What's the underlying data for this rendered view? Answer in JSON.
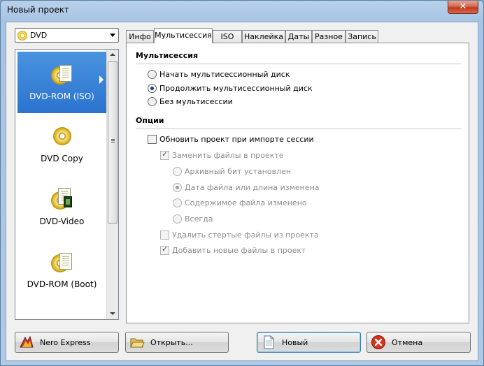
{
  "window": {
    "title": "Новый проект",
    "close_glyph": "✕"
  },
  "combo": {
    "value": "DVD",
    "icon": "dvd-disc-icon"
  },
  "projects": [
    {
      "label": "DVD-ROM (ISO)",
      "icon": "dvd-rom-iso-icon",
      "selected": true
    },
    {
      "label": "DVD Copy",
      "icon": "dvd-copy-icon",
      "selected": false
    },
    {
      "label": "DVD-Video",
      "icon": "dvd-video-icon",
      "selected": false
    },
    {
      "label": "DVD-ROM (Boot)",
      "icon": "dvd-rom-boot-icon",
      "selected": false
    }
  ],
  "tabs": [
    {
      "label": "Инфо",
      "active": false
    },
    {
      "label": "Мультисессия",
      "active": true
    },
    {
      "label": "ISO",
      "active": false
    },
    {
      "label": "Наклейка",
      "active": false
    },
    {
      "label": "Даты",
      "active": false
    },
    {
      "label": "Разное",
      "active": false
    },
    {
      "label": "Запись",
      "active": false
    }
  ],
  "multisession": {
    "title": "Мультисессия",
    "options": [
      {
        "label": "Начать мультисессионный диск",
        "checked": false
      },
      {
        "label": "Продолжить мультисессионный диск",
        "checked": true
      },
      {
        "label": "Без мультисессии",
        "checked": false
      }
    ]
  },
  "options": {
    "title": "Опции",
    "update_project": {
      "label": "Обновить проект при импорте сессии",
      "checked": false
    },
    "replace_files": {
      "label": "Заменить файлы в проекте",
      "checked": true
    },
    "replace_modes": [
      {
        "label": "Архивный бит установлен",
        "checked": false
      },
      {
        "label": "Дата файла или длина изменена",
        "checked": true
      },
      {
        "label": "Содержимое файла изменено",
        "checked": false
      },
      {
        "label": "Всегда",
        "checked": false
      }
    ],
    "remove_deleted": {
      "label": "Удалить стертые файлы из проекта",
      "checked": false
    },
    "add_new": {
      "label": "Добавить новые файлы в проект",
      "checked": true
    }
  },
  "buttons": {
    "nero_express": {
      "label": "Nero Express",
      "icon": "nero-express-icon"
    },
    "open": {
      "label": "Открыть...",
      "icon": "open-folder-icon"
    },
    "new": {
      "label": "Новый",
      "icon": "new-document-icon"
    },
    "cancel": {
      "label": "Отмена",
      "icon": "cancel-icon"
    }
  },
  "colors": {
    "selection": "#3a84d8",
    "window_frame": "#a6c4e4",
    "close_button": "#c0391f"
  }
}
